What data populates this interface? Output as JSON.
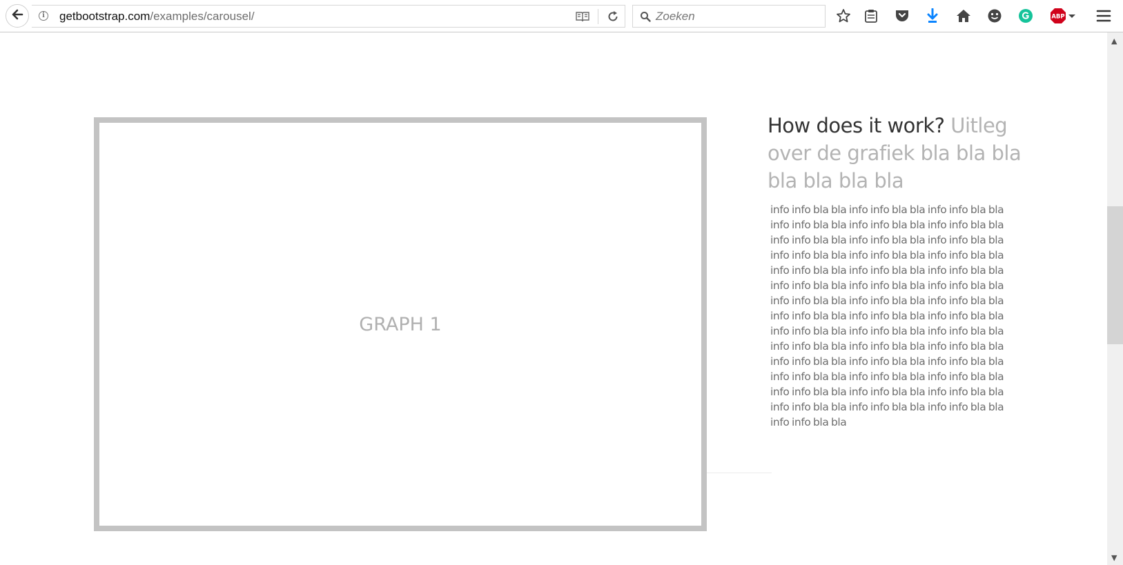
{
  "browser": {
    "url_domain": "getbootstrap.com",
    "url_path": "/examples/carousel/",
    "search_placeholder": "Zoeken",
    "icons": [
      "back-arrow-icon",
      "info-icon",
      "reader-view-icon",
      "reload-icon",
      "search-icon",
      "bookmark-star-icon",
      "clipboard-icon",
      "pocket-icon",
      "download-icon",
      "home-icon",
      "smiley-icon",
      "grammarly-icon",
      "adblock-icon",
      "menu-icon"
    ],
    "adblock_label": "ABP"
  },
  "graph": {
    "label": "GRAPH 1"
  },
  "explanation": {
    "heading": "How does it work?",
    "subheading": "Uitleg over de grafiek bla bla bla bla bla bla bla",
    "body": "info info bla bla info info bla bla info info bla bla info info bla bla info info bla bla info info bla bla info info bla bla info info bla bla info info bla bla info info bla bla info info bla bla info info bla bla info info bla bla info info bla bla info info bla bla info info bla bla info info bla bla info info bla bla info info bla bla info info bla bla info info bla bla info info bla bla info info bla bla info info bla bla info info bla bla info info bla bla info info bla bla info info bla bla info info bla bla info info bla bla info info bla bla info info bla bla info info bla bla info info bla bla info info bla bla info info bla bla info info bla bla info info bla bla info info bla bla info info bla bla info info bla bla info info bla bla info info bla bla"
  },
  "colors": {
    "toolbar_icon": "#555555",
    "download_blue": "#0a84ff",
    "grammarly_green": "#15c39a",
    "adblock_red": "#d0021b",
    "graph_border": "#c3c3c3"
  }
}
